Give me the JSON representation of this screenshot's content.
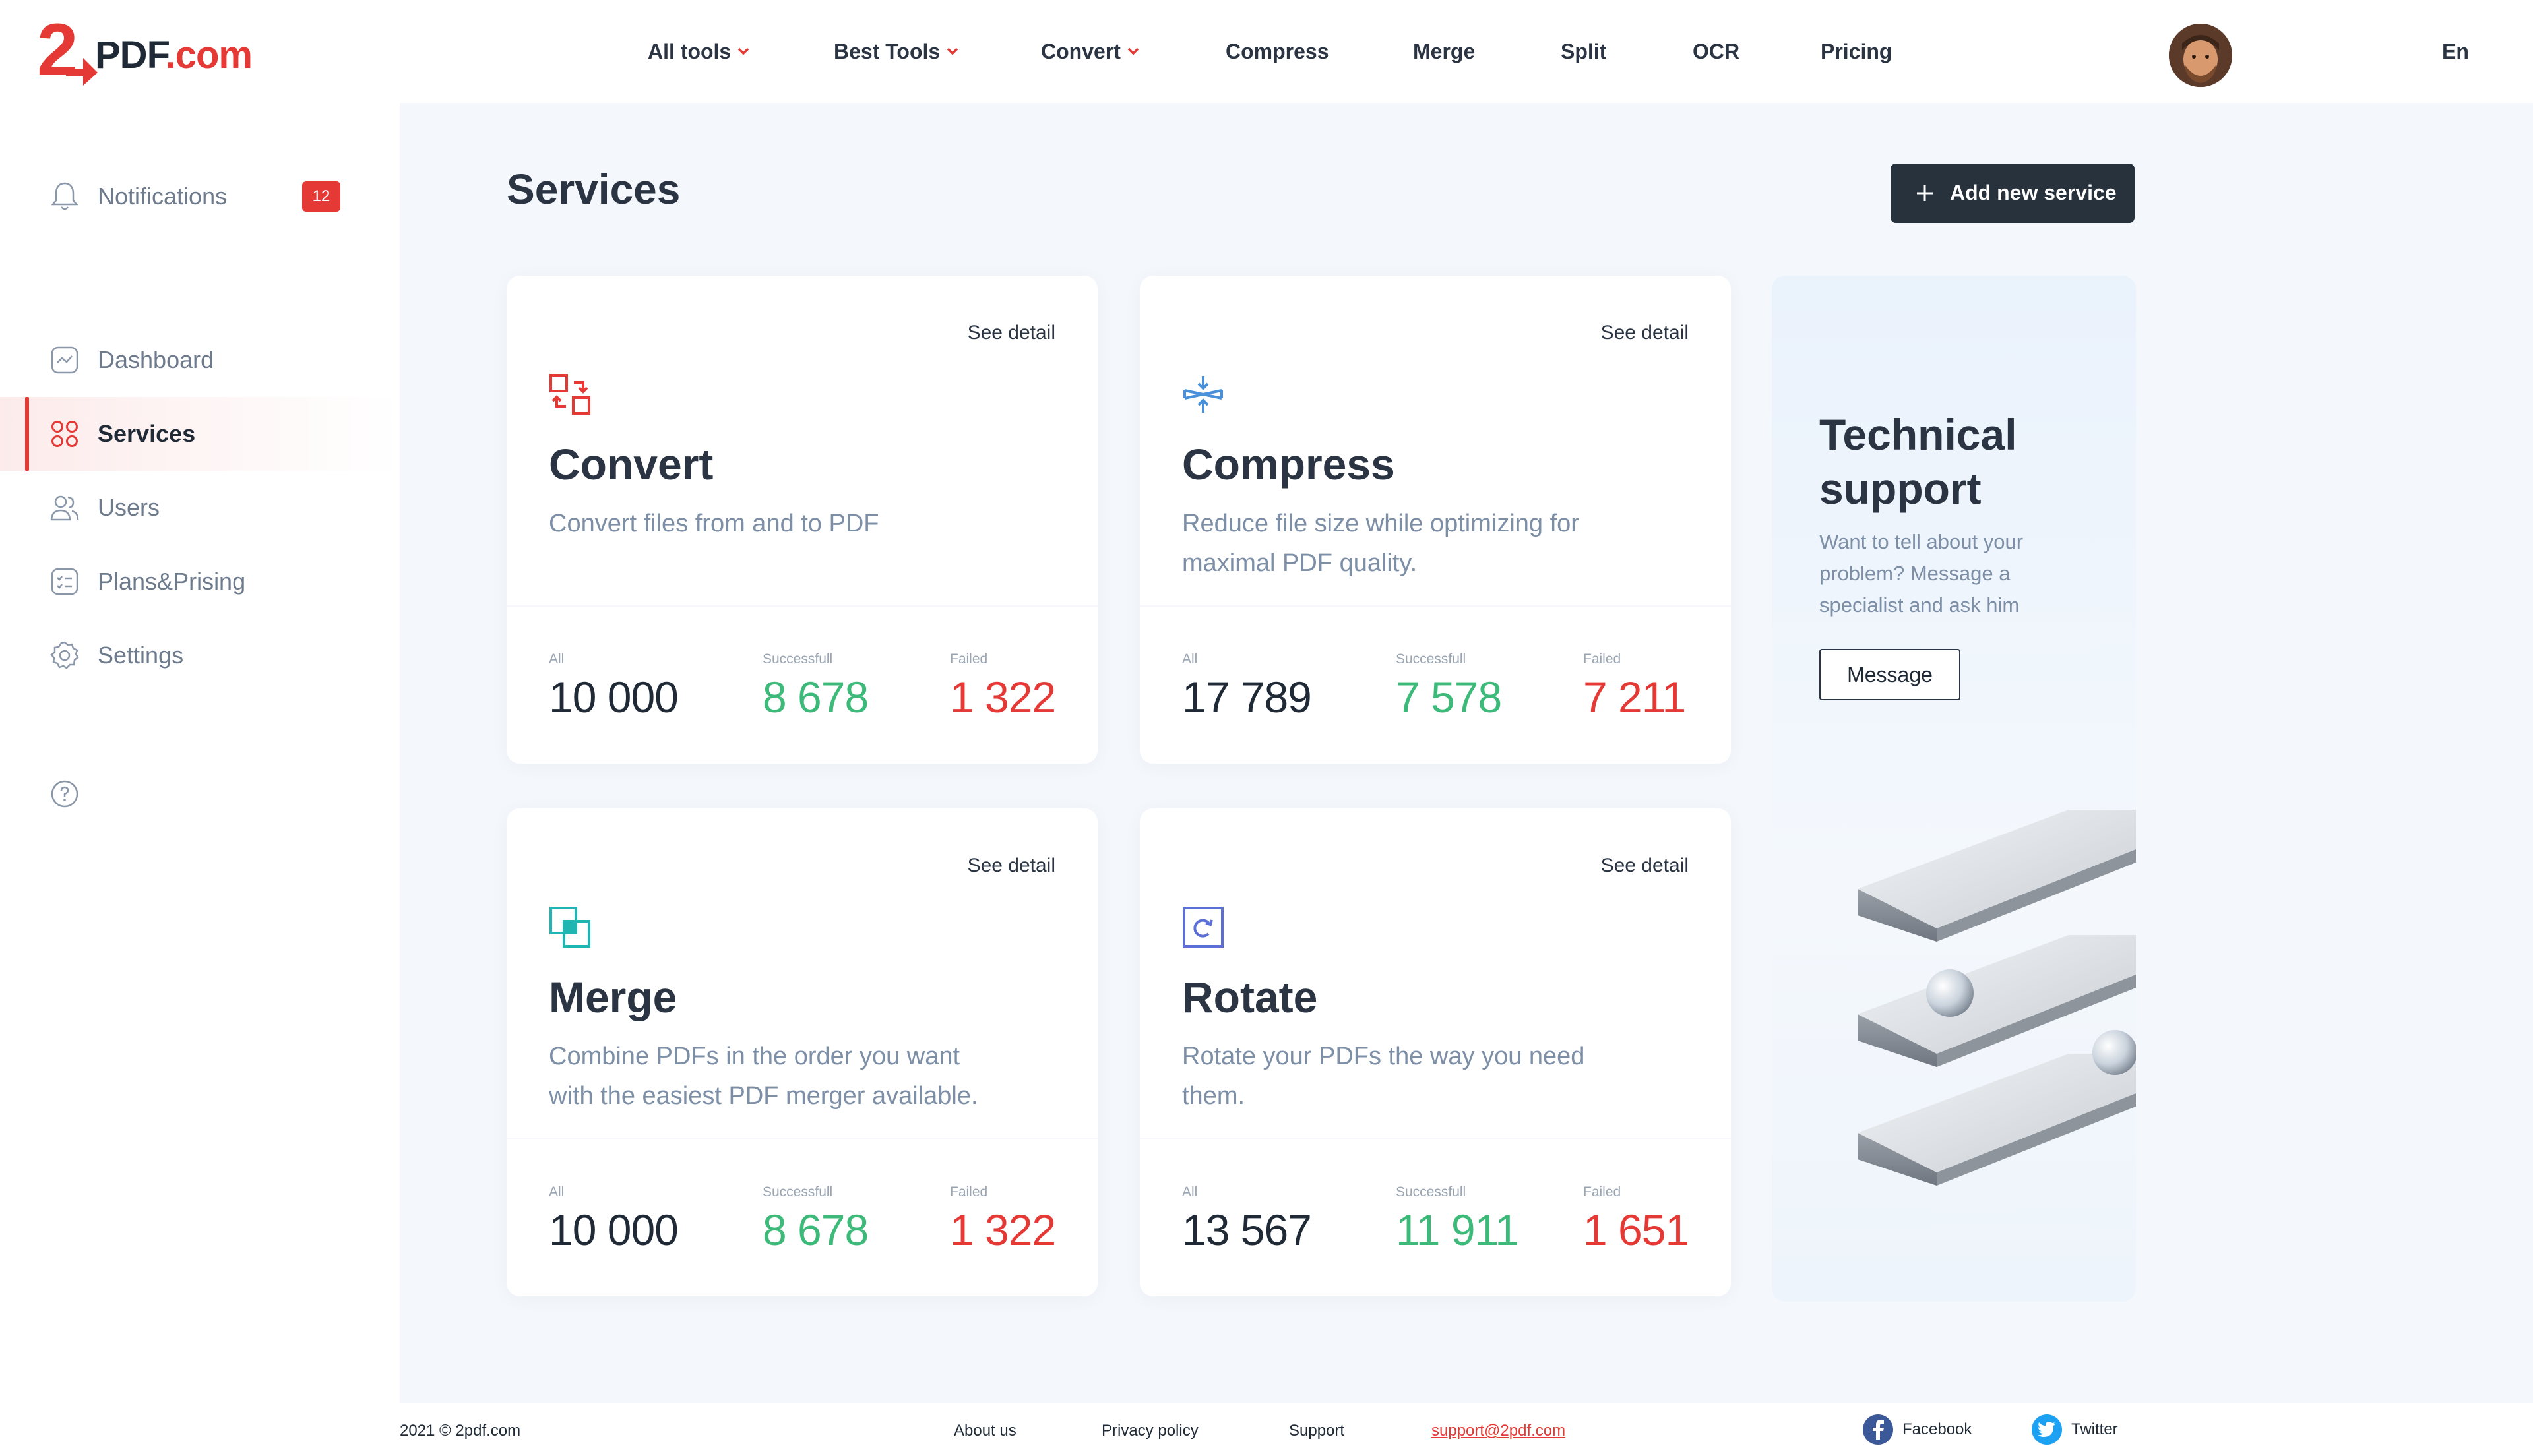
{
  "brand": {
    "logo_digit": "2",
    "logo_pdf": "PDF",
    "logo_com": ".com",
    "accent": "#e53935"
  },
  "topnav": {
    "items": [
      {
        "label": "All tools",
        "dropdown": true
      },
      {
        "label": "Best Tools",
        "dropdown": true
      },
      {
        "label": "Convert",
        "dropdown": true
      },
      {
        "label": "Compress",
        "dropdown": false
      },
      {
        "label": "Merge",
        "dropdown": false
      },
      {
        "label": "Split",
        "dropdown": false
      },
      {
        "label": "OCR",
        "dropdown": false
      },
      {
        "label": "Pricing",
        "dropdown": false
      }
    ],
    "language": "En"
  },
  "sidebar": {
    "notifications": {
      "label": "Notifications",
      "count": "12",
      "icon": "bell-icon"
    },
    "items": [
      {
        "label": "Dashboard",
        "icon": "chart-icon"
      },
      {
        "label": "Services",
        "icon": "grid-icon",
        "active": true
      },
      {
        "label": "Users",
        "icon": "users-icon"
      },
      {
        "label": "Plans&Prising",
        "icon": "list-icon"
      },
      {
        "label": "Settings",
        "icon": "gear-icon"
      }
    ],
    "help_icon": "help-icon"
  },
  "main": {
    "title": "Services",
    "add_button": "Add new service",
    "see_detail": "See detail",
    "stat_labels": {
      "all": "All",
      "ok": "Successfull",
      "fail": "Failed"
    },
    "cards": [
      {
        "title": "Convert",
        "description": "Convert files from and to PDF",
        "icon": "convert-icon",
        "all": "10 000",
        "ok": "8 678",
        "fail": "1 322"
      },
      {
        "title": "Compress",
        "description": "Reduce file size while optimizing for maximal PDF quality.",
        "icon": "compress-icon",
        "all": "17 789",
        "ok": "7 578",
        "fail": "7 211"
      },
      {
        "title": "Merge",
        "description": "Combine PDFs in the order you want with the easiest PDF merger available.",
        "icon": "merge-icon",
        "all": "10 000",
        "ok": "8 678",
        "fail": "1 322"
      },
      {
        "title": "Rotate",
        "description": "Rotate your PDFs the way you need them.",
        "icon": "rotate-icon",
        "all": "13 567",
        "ok": "11 911",
        "fail": "1 651"
      }
    ],
    "support": {
      "title": "Technical support",
      "description": "Want to tell about your problem? Message a specialist and ask him",
      "button": "Message"
    }
  },
  "footer": {
    "copyright": "2021 © 2pdf.com",
    "links": [
      "About us",
      "Privacy policy",
      "Support"
    ],
    "email": "support@2pdf.com",
    "social": [
      "Facebook",
      "Twitter"
    ]
  },
  "colors": {
    "success": "#3dba7a",
    "fail": "#e53935",
    "dark": "#27323d",
    "muted": "#7d8fa6"
  }
}
